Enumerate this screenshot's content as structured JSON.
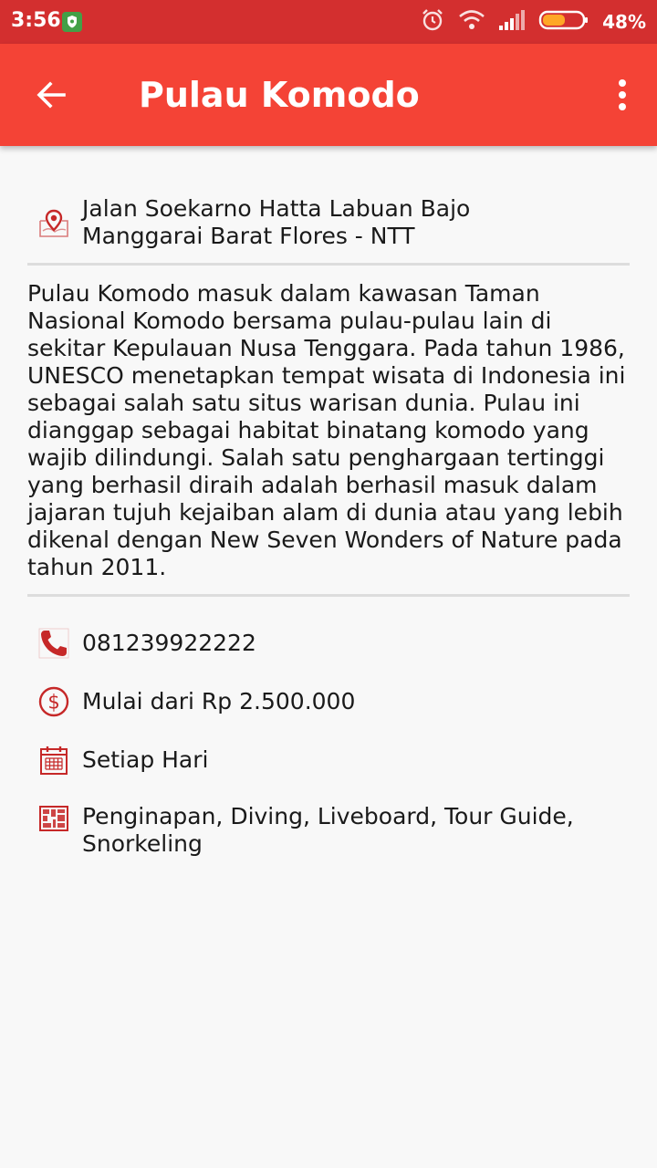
{
  "status_bar": {
    "time": "3:56",
    "battery": "48%"
  },
  "app_bar": {
    "title": "Pulau Komodo"
  },
  "address": {
    "line1": "Jalan Soekarno Hatta Labuan Bajo",
    "line2": "Manggarai Barat Flores - NTT"
  },
  "description": "Pulau Komodo masuk dalam kawasan Taman Nasional Komodo bersama pulau-pulau lain di sekitar Kepulauan Nusa Tenggara. Pada tahun 1986, UNESCO menetapkan tempat wisata di Indonesia ini sebagai salah satu situs warisan dunia. Pulau ini dianggap sebagai habitat binatang komodo yang wajib dilindungi. Salah satu penghargaan tertinggi yang berhasil diraih adalah berhasil masuk dalam jajaran tujuh kejaiban alam di dunia atau yang lebih dikenal dengan New Seven Wonders of Nature pada tahun 2011.",
  "details": {
    "phone": "081239922222",
    "price": "Mulai dari Rp 2.500.000",
    "schedule": "Setiap Hari",
    "facilities": "Penginapan, Diving, Liveboard, Tour Guide, Snorkeling"
  },
  "colors": {
    "app_bar": "#f44336",
    "status_bar": "#d32f2f",
    "icon_accent": "#c62828"
  },
  "icons": [
    "back-arrow-icon",
    "more-vert-icon",
    "map-pin-icon",
    "phone-icon",
    "dollar-icon",
    "calendar-icon",
    "map-icon"
  ]
}
